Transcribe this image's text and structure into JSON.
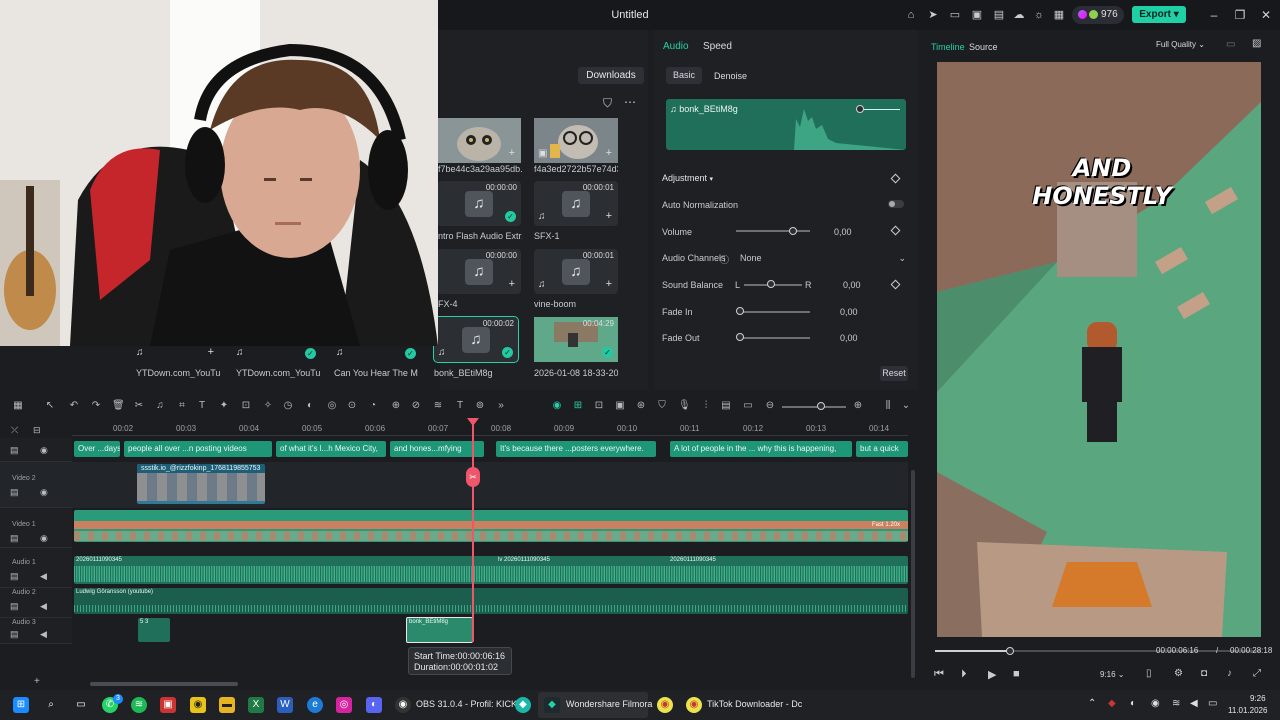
{
  "titlebar": {
    "title": "Untitled",
    "credits": "976",
    "export_label": "Export"
  },
  "media": {
    "downloads_label": "Downloads",
    "items": [
      {
        "caption": "f7be44c3a29aa95db...",
        "duration": ""
      },
      {
        "caption": "f4a3ed2722b57e74d3...",
        "duration": ""
      },
      {
        "caption": "ntro Flash Audio Extr...",
        "duration": "00:00:00"
      },
      {
        "caption": "SFX-1",
        "duration": "00:00:01"
      },
      {
        "caption": "FX-4",
        "duration": "00:00:00"
      },
      {
        "caption": "vine-boom",
        "duration": "00:00:01"
      },
      {
        "caption": "bonk_BEtiM8g",
        "duration": "00:00:02"
      },
      {
        "caption": "2026-01-08 18-33-20",
        "duration": "00:04:29"
      },
      {
        "caption": "YTDown.com_YouTu...",
        "duration": ""
      },
      {
        "caption": "YTDown.com_YouTu...",
        "duration": ""
      },
      {
        "caption": "Can You Hear The M...",
        "duration": ""
      }
    ]
  },
  "props": {
    "tabs": [
      "Audio",
      "Speed"
    ],
    "subtabs": [
      "Basic",
      "Denoise"
    ],
    "clip_name": "bonk_BEtiM8g",
    "section": "Adjustment",
    "auto_norm": "Auto Normalization",
    "volume": {
      "label": "Volume",
      "value": "0,00"
    },
    "channels": {
      "label": "Audio Channels",
      "value": "None"
    },
    "balance": {
      "label": "Sound Balance",
      "left": "L",
      "right": "R",
      "value": "0,00"
    },
    "fade_in": {
      "label": "Fade In",
      "value": "0,00"
    },
    "fade_out": {
      "label": "Fade Out",
      "value": "0,00"
    },
    "reset": "Reset"
  },
  "preview": {
    "tabs": [
      "Timeline",
      "Source"
    ],
    "quality": "Full Quality",
    "caption": "AND HONESTLY",
    "current_time": "00:00:06:16",
    "separator": "/",
    "total_time": "00:00:28:18",
    "ratio": "9:16",
    "progress": 0.23
  },
  "timeline": {
    "ticks": [
      "00:02",
      "00:03",
      "00:04",
      "00:05",
      "00:06",
      "00:07",
      "00:08",
      "00:09",
      "00:10",
      "00:11",
      "00:12",
      "00:13",
      "00:14"
    ],
    "tracks": [
      "",
      "Video 2",
      "Video 1",
      "Audio 1",
      "Audio 2",
      "Audio 3"
    ],
    "subtitles": [
      "Over ...days,",
      "people all over ...n posting videos",
      "of what it's l...h Mexico City,",
      "and hones...mfying",
      "It's because there ...posters everywhere.",
      "A lot of people in the ... why this is happening,",
      "but a quick"
    ],
    "video2_clip": "ssstik.io_@rizzfokinp_1768119855753",
    "video1_badge": "Fast 1.20x",
    "audio1_clips": [
      "20260111090345",
      "lv 20260111090345",
      "20260111090345"
    ],
    "audio2_clip": "Ludwig Göransson (youtube)",
    "audio3_clips": [
      "5 3",
      "bonk_BEtiM8g"
    ],
    "tooltip_start": "Start Time:00:00:06:16",
    "tooltip_duration": "Duration:00:00:01:02"
  },
  "taskbar": {
    "obs": "OBS 31.0.4 - Profil: KICK",
    "filmora": "Wondershare Filmora",
    "tiktok": "TikTok Downloader - Dc",
    "time": "9:26",
    "date": "11.01.2026",
    "badge": "3"
  }
}
